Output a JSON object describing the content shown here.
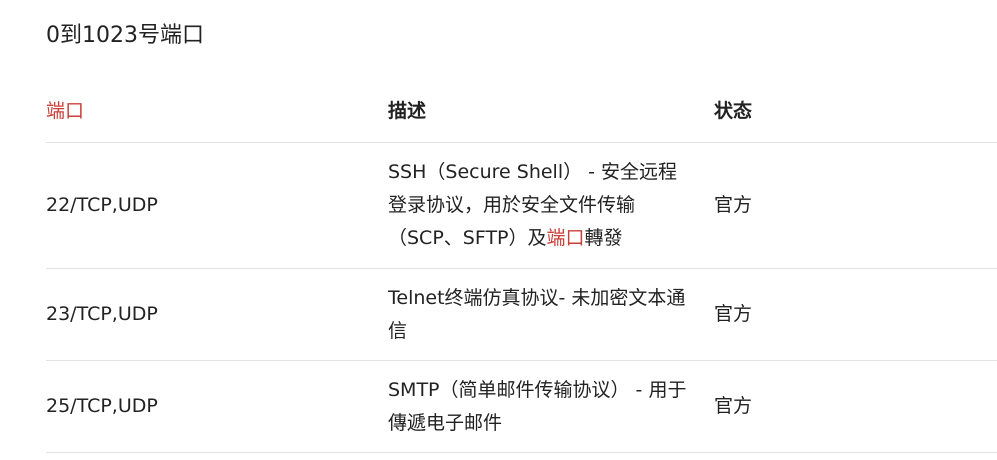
{
  "heading": "0到1023号端口",
  "colors": {
    "link": "#c9403a",
    "divider": "#e3e3e3",
    "text": "#222222"
  },
  "table": {
    "headers": {
      "port": "端口",
      "description": "描述",
      "status": "状态"
    },
    "rows": [
      {
        "port": "22/TCP,UDP",
        "desc_before": "SSH（Secure Shell） - 安全远程登录协议，用於安全文件传输（SCP、SFTP）及",
        "desc_link": "端口",
        "desc_after": "轉發",
        "status": "官方"
      },
      {
        "port": "23/TCP,UDP",
        "desc_before": "Telnet终端仿真协议- 未加密文本通信",
        "desc_link": "",
        "desc_after": "",
        "status": "官方"
      },
      {
        "port": "25/TCP,UDP",
        "desc_before": "SMTP（简单邮件传输协议） - 用于傳遞电子邮件",
        "desc_link": "",
        "desc_after": "",
        "status": "官方"
      }
    ]
  }
}
